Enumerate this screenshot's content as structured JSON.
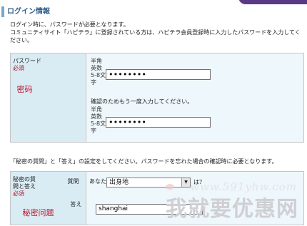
{
  "header": {
    "title": "ログイン情報"
  },
  "intro": {
    "line1": "ログイン時に、パスワードが必要となります。",
    "line2": "コミュニティサイト「ハピテラ」に登録されている方は、ハピテラ会員登録時に入力したパスワードを入力してください。"
  },
  "password": {
    "label": "パスワード",
    "required": "必須",
    "cn_annotation": "密码",
    "hint": "半角英数5-8文字",
    "value": "••••••••",
    "confirm_note": "確認のためもう一度入力してください。",
    "confirm_hint": "半角英数5-8文字",
    "confirm_value": "••••••••"
  },
  "secret": {
    "note": "「秘密の質問」と「答え」の設定をしてください。パスワードを忘れた場合の確認時に必要となります。",
    "label": "秘密の質問と答え",
    "required": "必須",
    "cn_annotation": "秘密问题",
    "question_label": "質問",
    "prefix": "あなたの",
    "selected": "出身地",
    "suffix": "は？",
    "answer_label": "答え",
    "answer_value": "shanghai"
  },
  "watermark": {
    "url": "www.591yhw.com",
    "brand": "我就要优惠网"
  }
}
